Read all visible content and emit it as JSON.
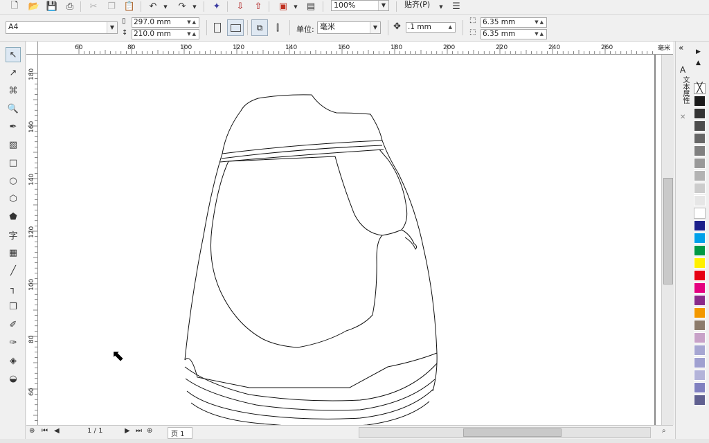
{
  "toolbar": {
    "zoom": "100%",
    "snap_label": "贴齐(P)"
  },
  "propbar": {
    "page_size": "A4",
    "width": "297.0 mm",
    "height": "210.0 mm",
    "unit_label": "单位:",
    "unit_value": "毫米",
    "nudge": ".1 mm",
    "dup_x": "6.35 mm",
    "dup_y": "6.35 mm"
  },
  "ruler": {
    "h_ticks": [
      "60",
      "80",
      "100",
      "120",
      "140",
      "160",
      "180",
      "200",
      "220",
      "240",
      "260"
    ],
    "h_unit": "毫米",
    "v_ticks": [
      "180",
      "160",
      "140",
      "120",
      "100",
      "80",
      "60"
    ]
  },
  "docker": {
    "tab_label": "文本属性"
  },
  "palette": {
    "colors": [
      "#1a1a1a",
      "#333333",
      "#4d4d4d",
      "#666666",
      "#808080",
      "#999999",
      "#b3b3b3",
      "#cccccc",
      "#e6e6e6",
      "#ffffff",
      "#1b1f8a",
      "#00a0e9",
      "#009944",
      "#fff000",
      "#e60012",
      "#e4007f",
      "#8a2a8a",
      "#f39800",
      "#8c7b6b",
      "#c8a2c8",
      "#a6a6d2",
      "#9fa0d0",
      "#b3b3d9",
      "#8080c0",
      "#606090"
    ]
  },
  "pager": {
    "page_count": "1 / 1",
    "page_tab": "页 1"
  }
}
